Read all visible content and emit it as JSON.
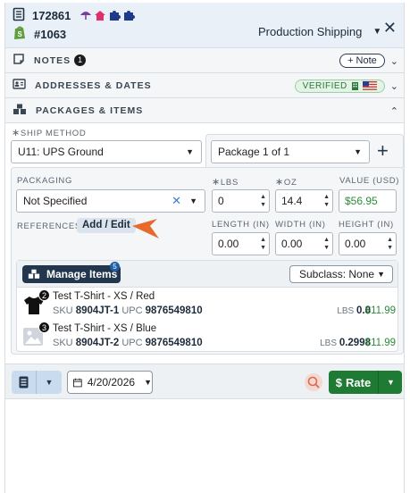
{
  "header": {
    "order_id": "172861",
    "order_number": "#1063",
    "shipping_profile": "Production Shipping",
    "tag_colors": [
      "#7b3fa0",
      "#e0306a",
      "#1e3a8a",
      "#1e3a8a"
    ]
  },
  "notes": {
    "label": "NOTES",
    "count": "1",
    "add_note_label": "+ Note"
  },
  "addresses": {
    "label": "ADDRESSES & DATES",
    "verified_label": "VERIFIED"
  },
  "packages": {
    "label": "PACKAGES & ITEMS",
    "ship_method_label": "SHIP METHOD",
    "ship_method_value": "U11: UPS Ground",
    "package_select_value": "Package 1 of 1",
    "packaging_label": "PACKAGING",
    "packaging_value": "Not Specified",
    "lbs_label": "LBS",
    "lbs_value": "0",
    "oz_label": "OZ",
    "oz_value": "14.4",
    "value_label": "VALUE (USD)",
    "value_value": "$56.95",
    "references_label": "REFERENCES",
    "add_edit_label": "Add / Edit",
    "length_label": "LENGTH (IN)",
    "length_value": "0.00",
    "width_label": "WIDTH (IN)",
    "width_value": "0.00",
    "height_label": "HEIGHT (IN)",
    "height_value": "0.00"
  },
  "items_panel": {
    "manage_items_label": "Manage Items",
    "manage_items_count": "5",
    "subclass_value": "Subclass: None",
    "items": [
      {
        "qty": "2",
        "name": "Test T-Shirt - XS / Red",
        "sku_label": "SKU",
        "sku": "8904JT-1",
        "upc_label": "UPC",
        "upc": "9876549810",
        "lbs_label": "LBS",
        "weight": "0.0",
        "price": "$11.99"
      },
      {
        "qty": "3",
        "name": "Test T-Shirt - XS / Blue",
        "sku_label": "SKU",
        "sku": "8904JT-2",
        "upc_label": "UPC",
        "upc": "9876549810",
        "lbs_label": "LBS",
        "weight": "0.2998",
        "price": "$11.99"
      }
    ]
  },
  "footer": {
    "ship_date": "4/20/2026",
    "rate_label": "Rate",
    "rate_symbol": "$"
  }
}
